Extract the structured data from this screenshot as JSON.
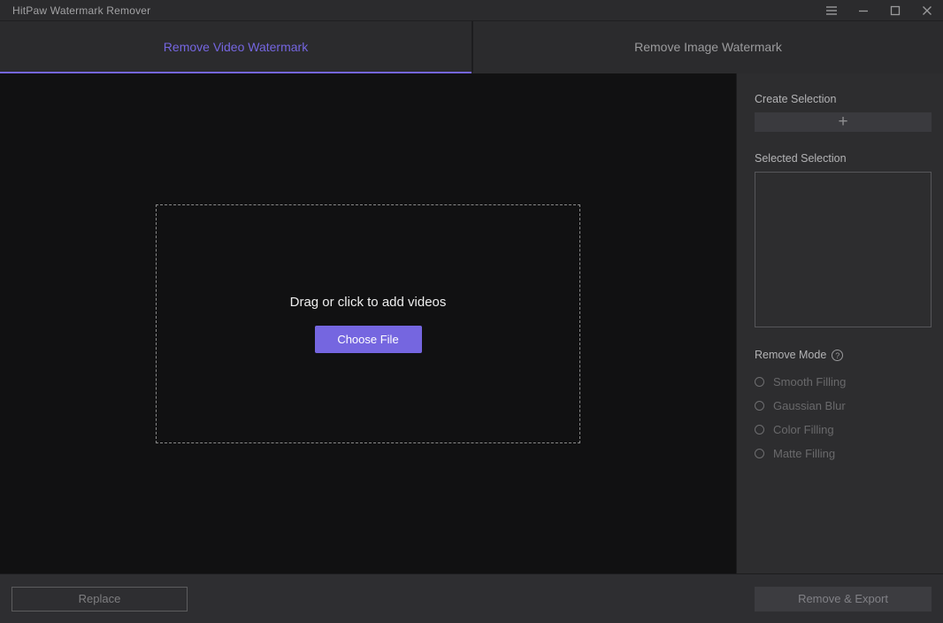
{
  "window": {
    "title": "HitPaw Watermark Remover"
  },
  "tabs": [
    {
      "label": "Remove Video Watermark",
      "active": true
    },
    {
      "label": "Remove Image Watermark",
      "active": false
    }
  ],
  "dropzone": {
    "message": "Drag or click to add videos",
    "choose_file_label": "Choose File"
  },
  "sidebar": {
    "create_selection_label": "Create Selection",
    "add_selection_icon": "+",
    "selected_selection_label": "Selected Selection",
    "remove_mode_label": "Remove Mode",
    "help_icon": "?",
    "modes": [
      {
        "label": "Smooth Filling",
        "selected": false
      },
      {
        "label": "Gaussian Blur",
        "selected": false
      },
      {
        "label": "Color Filling",
        "selected": false
      },
      {
        "label": "Matte Filling",
        "selected": false
      }
    ]
  },
  "footer": {
    "replace_label": "Replace",
    "remove_export_label": "Remove & Export"
  },
  "colors": {
    "accent": "#7566e0",
    "titlebar_bg": "#2b2b2d",
    "main_bg": "#111112",
    "sidebar_bg": "#2d2d2f",
    "footer_bg": "#2e2e31",
    "disabled_text": "#69696b"
  }
}
